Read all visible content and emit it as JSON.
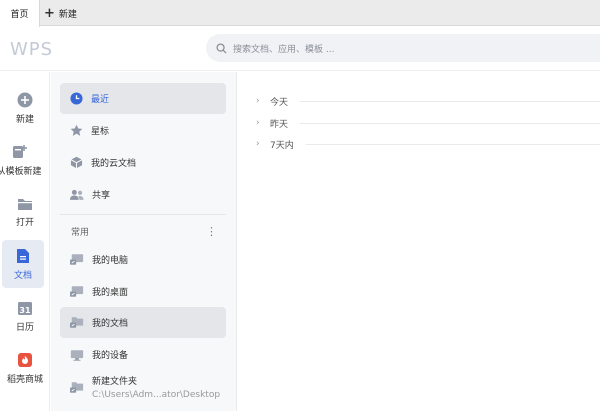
{
  "tabs": {
    "home": "首页",
    "new_tab": "新建"
  },
  "header": {
    "logo": "WPS",
    "search_placeholder": "搜索文档、应用、模板 ..."
  },
  "rail": [
    {
      "label": "新建",
      "icon": "plus-circle-icon"
    },
    {
      "label": "从模板新建",
      "icon": "template-new-icon"
    },
    {
      "label": "打开",
      "icon": "folder-open-icon"
    },
    {
      "label": "文档",
      "icon": "document-icon",
      "active": true
    },
    {
      "label": "日历",
      "icon": "calendar-icon",
      "day": "31"
    },
    {
      "label": "稻壳商城",
      "icon": "docer-store-icon"
    }
  ],
  "sidebar": {
    "items": [
      {
        "label": "最近",
        "icon": "clock-icon",
        "active": true
      },
      {
        "label": "星标",
        "icon": "star-icon"
      },
      {
        "label": "我的云文档",
        "icon": "cloud-cube-icon"
      },
      {
        "label": "共享",
        "icon": "people-icon"
      }
    ],
    "section_title": "常用",
    "section_more": "⋮",
    "common": [
      {
        "label": "我的电脑",
        "icon": "computer-icon"
      },
      {
        "label": "我的桌面",
        "icon": "desktop-icon"
      },
      {
        "label": "我的文档",
        "icon": "folder-icon",
        "active": true
      },
      {
        "label": "我的设备",
        "icon": "device-icon"
      },
      {
        "label": "新建文件夹",
        "path": "C:\\Users\\Adm...ator\\Desktop",
        "icon": "folder-icon"
      }
    ]
  },
  "main": {
    "groups": [
      {
        "label": "今天"
      },
      {
        "label": "昨天"
      },
      {
        "label": "7天内"
      }
    ]
  },
  "colors": {
    "accent": "#3a67d8",
    "sidebar_bg": "#f7f8fa",
    "active_bg": "#e4e6ea",
    "docer_red": "#e8523f"
  }
}
